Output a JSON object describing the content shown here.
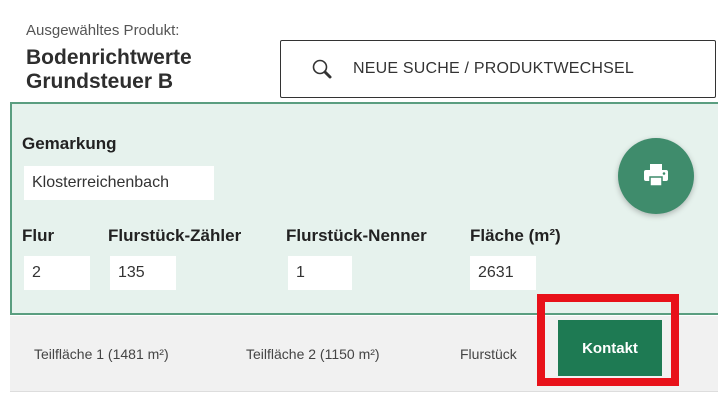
{
  "header": {
    "selected_label": "Ausgewähltes Produkt:",
    "product_name": "Bodenrichtwerte Grundsteuer B"
  },
  "search": {
    "icon": "search-icon",
    "label": "NEUE SUCHE / PRODUKTWECHSEL"
  },
  "form": {
    "gemarkung_label": "Gemarkung",
    "gemarkung_value": "Klosterreichenbach",
    "flur_label": "Flur",
    "flur_value": "2",
    "zaehler_label": "Flurstück-Zähler",
    "zaehler_value": "135",
    "nenner_label": "Flurstück-Nenner",
    "nenner_value": "1",
    "flaeche_label": "Fläche (m²)",
    "flaeche_value": "2631",
    "print_icon": "printer-icon"
  },
  "tabs": [
    {
      "label": "Teilfläche 1 (1481 m²)"
    },
    {
      "label": "Teilfläche 2 (1150 m²)"
    },
    {
      "label": "Flurstück"
    }
  ],
  "contact_label": "Kontakt",
  "colors": {
    "panel_bg": "#e6f2ed",
    "panel_border": "#5a9e80",
    "accent_green": "#1e7a53",
    "print_button": "#3f8c6c",
    "highlight": "#e8121a"
  }
}
